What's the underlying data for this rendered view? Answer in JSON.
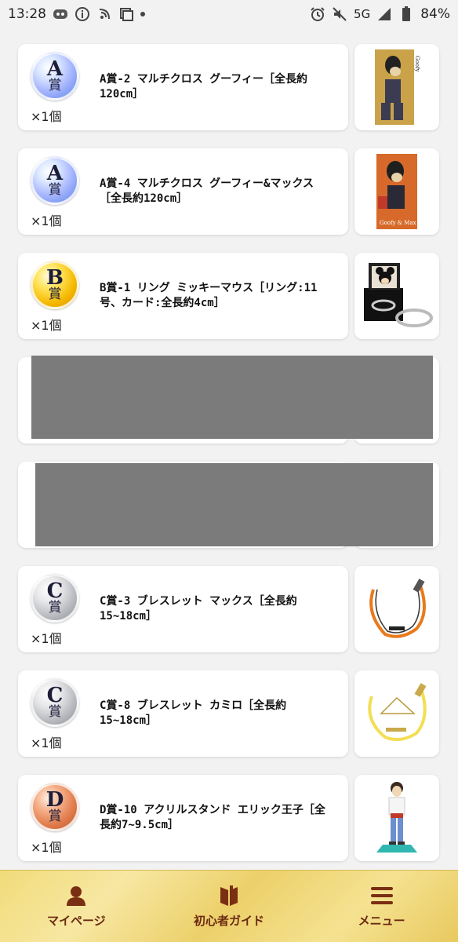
{
  "status_bar": {
    "time": "13:28",
    "network": "5G",
    "battery": "84%"
  },
  "prizes": [
    {
      "tier": "a",
      "letter": "A",
      "kanji": "賞",
      "name": "A賞-2 マルチクロス グーフィー［全長約120cm］",
      "qty": "×1個",
      "thumb": "goofy-cloth"
    },
    {
      "tier": "a",
      "letter": "A",
      "kanji": "賞",
      "name": "A賞-4 マルチクロス グーフィー&マックス［全長約120cm］",
      "qty": "×1個",
      "thumb": "goofy-max-cloth"
    },
    {
      "tier": "b",
      "letter": "B",
      "kanji": "賞",
      "name": "B賞-1 リング ミッキーマウス［リング:11号、カード:全長約4cm］",
      "qty": "×1個",
      "thumb": "mickey-ring"
    },
    {
      "redacted": true
    },
    {
      "redacted": true
    },
    {
      "tier": "c",
      "letter": "C",
      "kanji": "賞",
      "name": "C賞-3 ブレスレット マックス［全長約15~18cm］",
      "qty": "×1個",
      "thumb": "bracelet-orange"
    },
    {
      "tier": "c",
      "letter": "C",
      "kanji": "賞",
      "name": "C賞-8 ブレスレット カミロ［全長約15~18cm］",
      "qty": "×1個",
      "thumb": "bracelet-yellow"
    },
    {
      "tier": "d",
      "letter": "D",
      "kanji": "賞",
      "name": "D賞-10 アクリルスタンド エリック王子［全長約7~9.5cm］",
      "qty": "×1個",
      "thumb": "acrylic-stand"
    }
  ],
  "thumb_texts": {
    "goofy_label": "Goofy",
    "goofy_max_label": "Goofy & Max"
  },
  "nav": {
    "mypage": "マイページ",
    "guide": "初心者ガイド",
    "menu": "メニュー"
  }
}
